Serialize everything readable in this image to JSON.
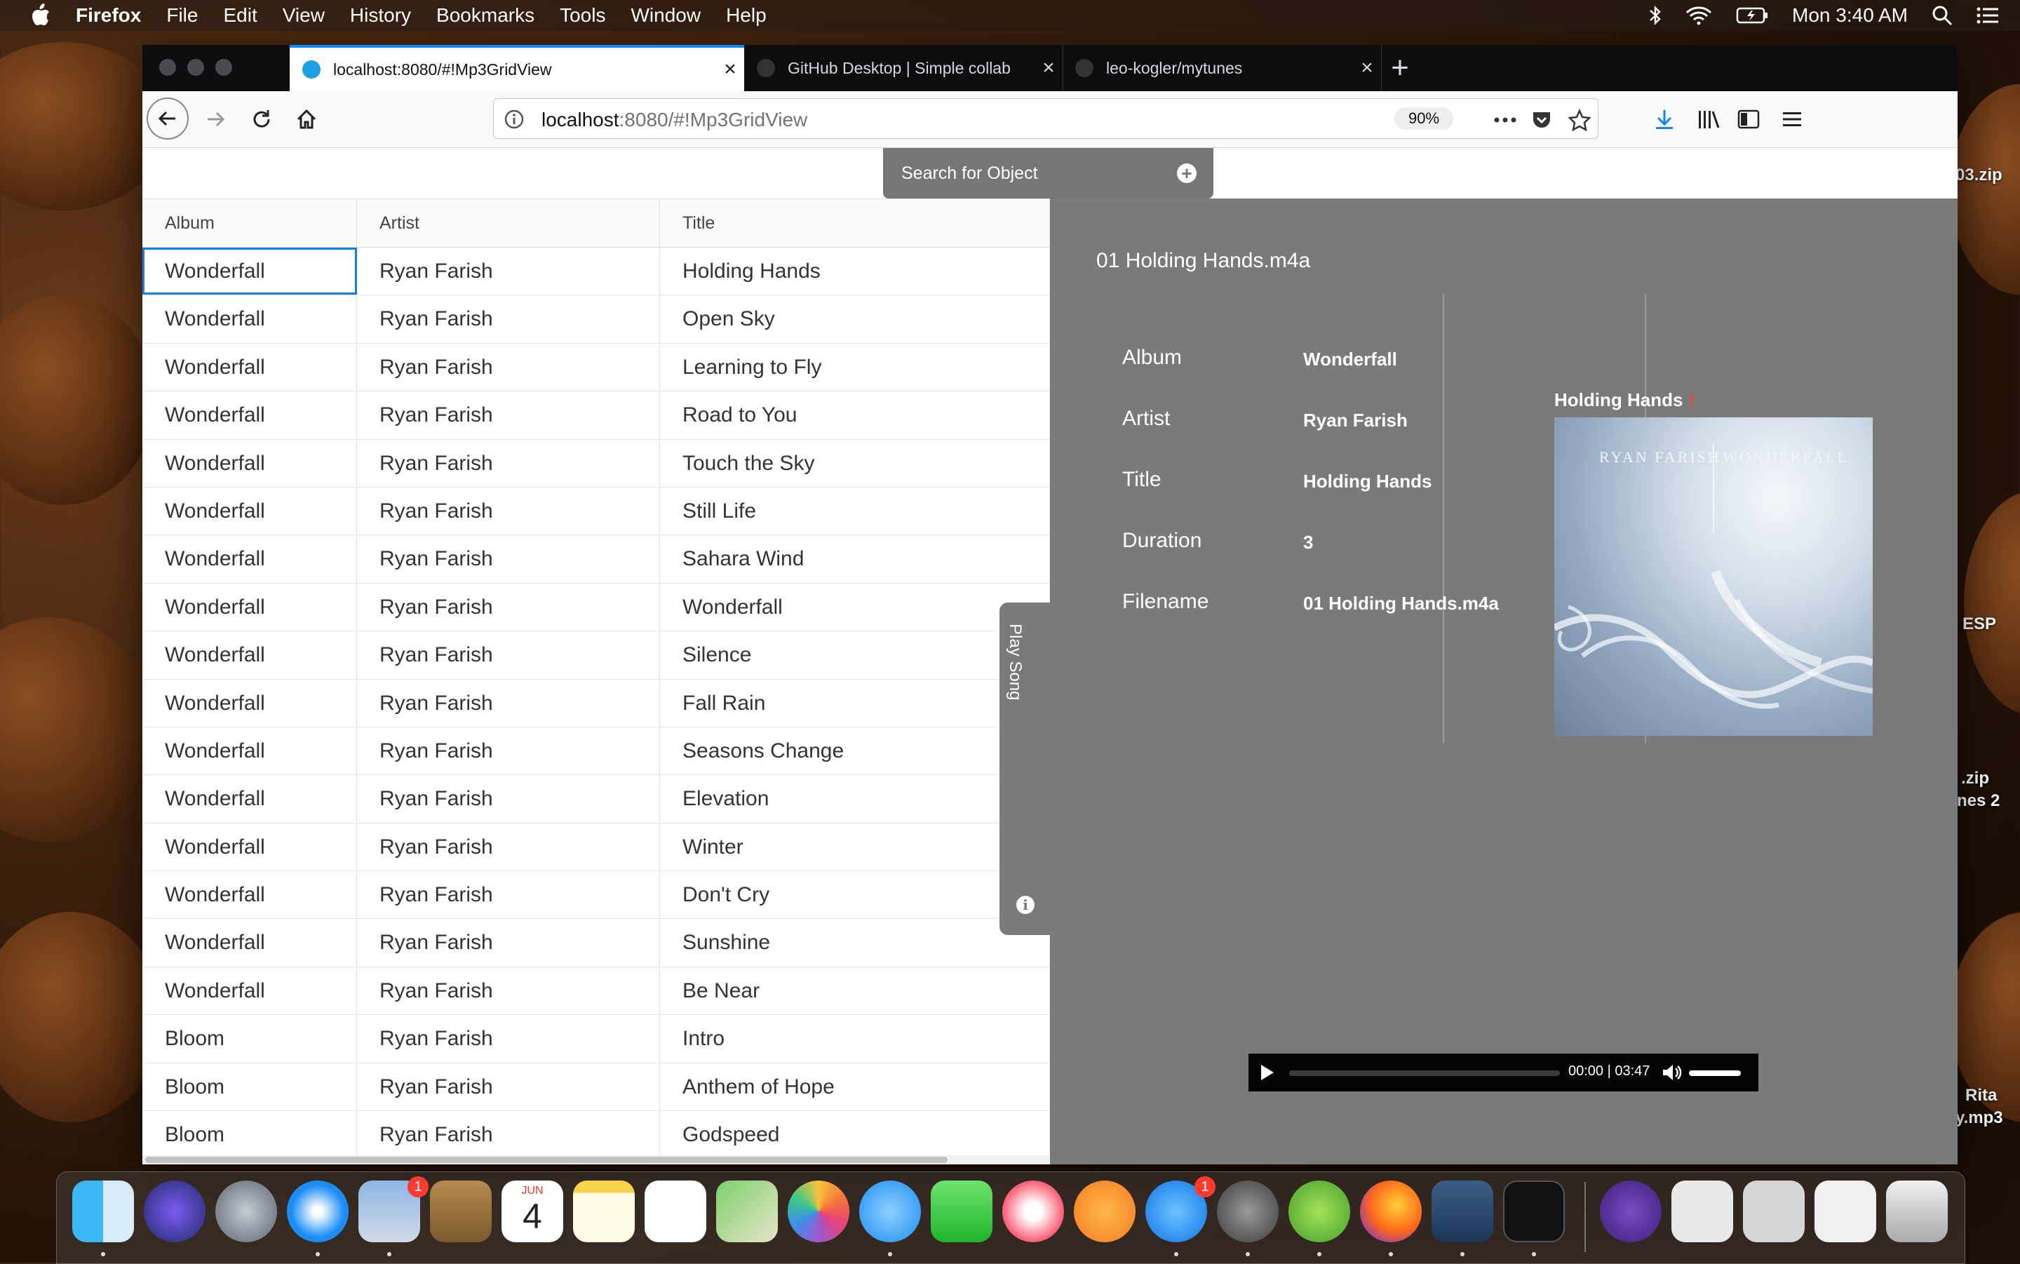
{
  "menubar": {
    "app_name": "Firefox",
    "items": [
      "File",
      "Edit",
      "View",
      "History",
      "Bookmarks",
      "Tools",
      "Window",
      "Help"
    ],
    "clock": "Mon 3:40 AM"
  },
  "browser": {
    "tabs": [
      {
        "label": "localhost:8080/#!Mp3GridView",
        "active": true
      },
      {
        "label": "GitHub Desktop | Simple collab",
        "active": false
      },
      {
        "label": "leo-kogler/mytunes",
        "active": false
      }
    ],
    "url_host": "localhost",
    "url_path": ":8080/#!Mp3GridView",
    "zoom": "90%"
  },
  "search": {
    "label": "Search for Object"
  },
  "grid": {
    "columns": [
      "Album",
      "Artist",
      "Title"
    ],
    "rows": [
      [
        "Wonderfall",
        "Ryan Farish",
        "Holding Hands"
      ],
      [
        "Wonderfall",
        "Ryan Farish",
        "Open Sky"
      ],
      [
        "Wonderfall",
        "Ryan Farish",
        "Learning to Fly"
      ],
      [
        "Wonderfall",
        "Ryan Farish",
        "Road to You"
      ],
      [
        "Wonderfall",
        "Ryan Farish",
        "Touch the Sky"
      ],
      [
        "Wonderfall",
        "Ryan Farish",
        "Still Life"
      ],
      [
        "Wonderfall",
        "Ryan Farish",
        "Sahara Wind"
      ],
      [
        "Wonderfall",
        "Ryan Farish",
        "Wonderfall"
      ],
      [
        "Wonderfall",
        "Ryan Farish",
        "Silence"
      ],
      [
        "Wonderfall",
        "Ryan Farish",
        "Fall Rain"
      ],
      [
        "Wonderfall",
        "Ryan Farish",
        "Seasons Change"
      ],
      [
        "Wonderfall",
        "Ryan Farish",
        "Elevation"
      ],
      [
        "Wonderfall",
        "Ryan Farish",
        "Winter"
      ],
      [
        "Wonderfall",
        "Ryan Farish",
        "Don't Cry"
      ],
      [
        "Wonderfall",
        "Ryan Farish",
        "Sunshine"
      ],
      [
        "Wonderfall",
        "Ryan Farish",
        "Be Near"
      ],
      [
        "Bloom",
        "Ryan Farish",
        "Intro"
      ],
      [
        "Bloom",
        "Ryan Farish",
        "Anthem of Hope"
      ],
      [
        "Bloom",
        "Ryan Farish",
        "Godspeed"
      ]
    ]
  },
  "play_song": {
    "label": "Play Song"
  },
  "detail": {
    "heading": "01 Holding Hands.m4a",
    "labels": [
      "Album",
      "Artist",
      "Title",
      "Duration",
      "Filename"
    ],
    "values": [
      "Wonderfall",
      "Ryan Farish",
      "Holding Hands",
      "3",
      "01 Holding Hands.m4a"
    ],
    "cover_title": "Holding Hands",
    "cover_required_mark": "!",
    "cover_artist": "RYAN FARISH",
    "cover_album": "WONDERFALL"
  },
  "player": {
    "time": "00:00 | 03:47"
  },
  "desktop_labels": {
    "zip1": "03.zip",
    "esp": "ESP",
    "zip2": ".zip",
    "nes2": "nes 2",
    "rita": "Rita",
    "mp3": "y.mp3"
  },
  "dock": {
    "calendar_month": "JUN",
    "calendar_day": "4",
    "badge_mail": "1",
    "badge_appstore": "1"
  },
  "colors": {
    "accent": "#0a84ff",
    "detail_bg": "#7a7a7a",
    "focus": "#197de1"
  }
}
